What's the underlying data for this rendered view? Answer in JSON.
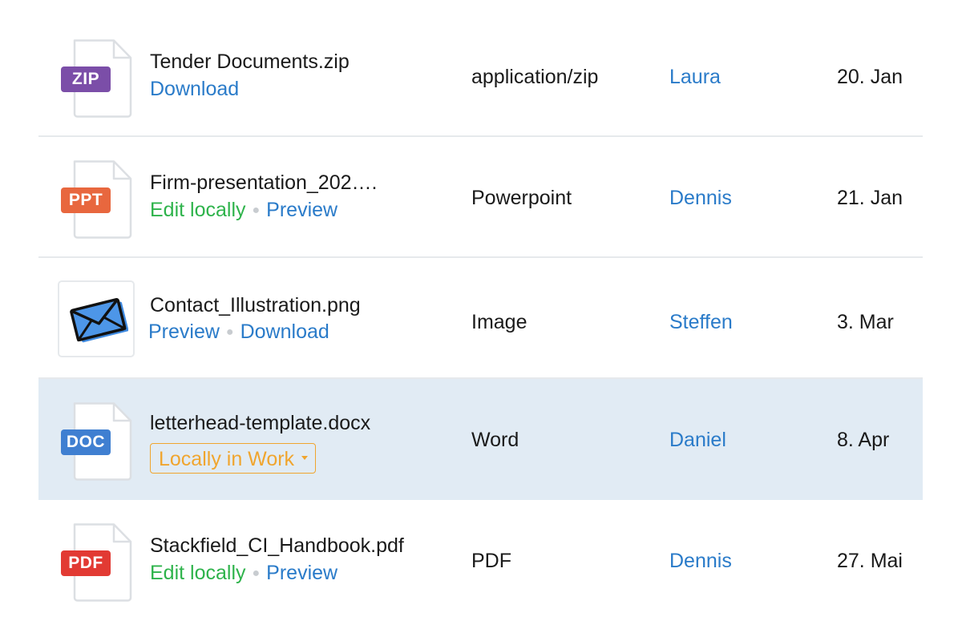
{
  "files": [
    {
      "name": "Tender Documents.zip",
      "badge": "ZIP",
      "badge_color": "#7b4ea8",
      "actions": {
        "download": "Download"
      },
      "type": "application/zip",
      "owner": "Laura",
      "date": "20. Jan"
    },
    {
      "name": "Firm-presentation_202….",
      "badge": "PPT",
      "badge_color": "#e8673e",
      "actions": {
        "edit": "Edit locally",
        "preview": "Preview"
      },
      "type": "Powerpoint",
      "owner": "Dennis",
      "date": "21. Jan"
    },
    {
      "name": "Contact_Illustration.png",
      "thumbnail_icon": "envelope-icon",
      "actions": {
        "preview": "Preview",
        "download": "Download"
      },
      "type": "Image",
      "owner": "Steffen",
      "date": "3. Mar"
    },
    {
      "name": "letterhead-template.docx",
      "badge": "DOC",
      "badge_color": "#3f7fd1",
      "status": "Locally in Work",
      "type": "Word",
      "owner": "Daniel",
      "date": "8. Apr"
    },
    {
      "name": "Stackfield_CI_Handbook.pdf",
      "badge": "PDF",
      "badge_color": "#e23a33",
      "actions": {
        "edit": "Edit locally",
        "preview": "Preview"
      },
      "type": "PDF",
      "owner": "Dennis",
      "date": "27. Mai"
    }
  ],
  "colors": {
    "link": "#2a7bc9",
    "edit": "#2eb34b",
    "status": "#f0a52e",
    "selected_row": "#e1ebf4",
    "divider": "#e6e9ec"
  }
}
